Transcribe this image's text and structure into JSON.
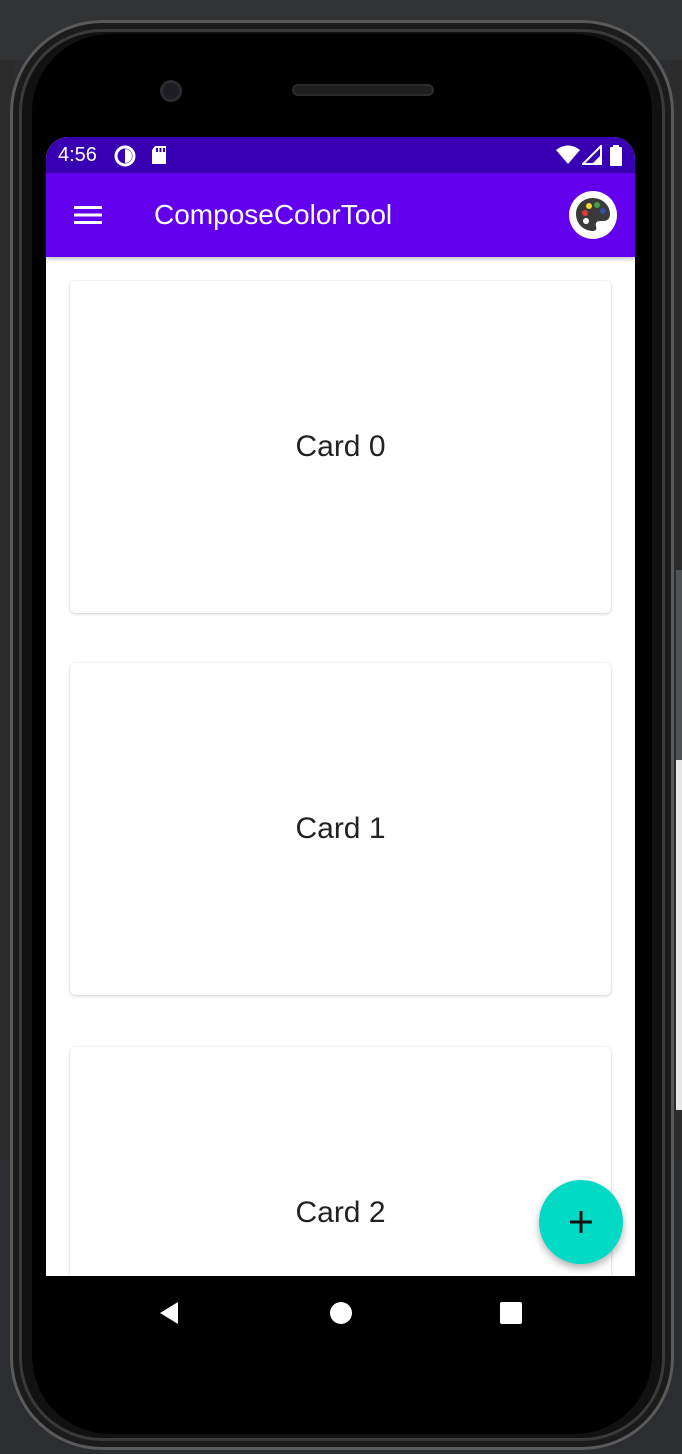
{
  "status_bar": {
    "time": "4:56",
    "left_icons": [
      "data-saver-icon",
      "sd-card-icon"
    ],
    "right_icons": [
      "wifi-icon",
      "cell-signal-icon",
      "battery-icon"
    ]
  },
  "app_bar": {
    "title": "ComposeColorTool",
    "menu_icon": "hamburger-menu-icon",
    "action_icon": "palette-icon"
  },
  "cards": [
    {
      "label": "Card 0"
    },
    {
      "label": "Card 1"
    },
    {
      "label": "Card 2"
    }
  ],
  "fab": {
    "icon": "plus-icon"
  },
  "nav_bar": {
    "buttons": [
      "back-icon",
      "home-icon",
      "recents-icon"
    ]
  },
  "colors": {
    "primary": "#6200ee",
    "primary_variant": "#3700b3",
    "secondary": "#03dac5",
    "surface": "#ffffff"
  }
}
